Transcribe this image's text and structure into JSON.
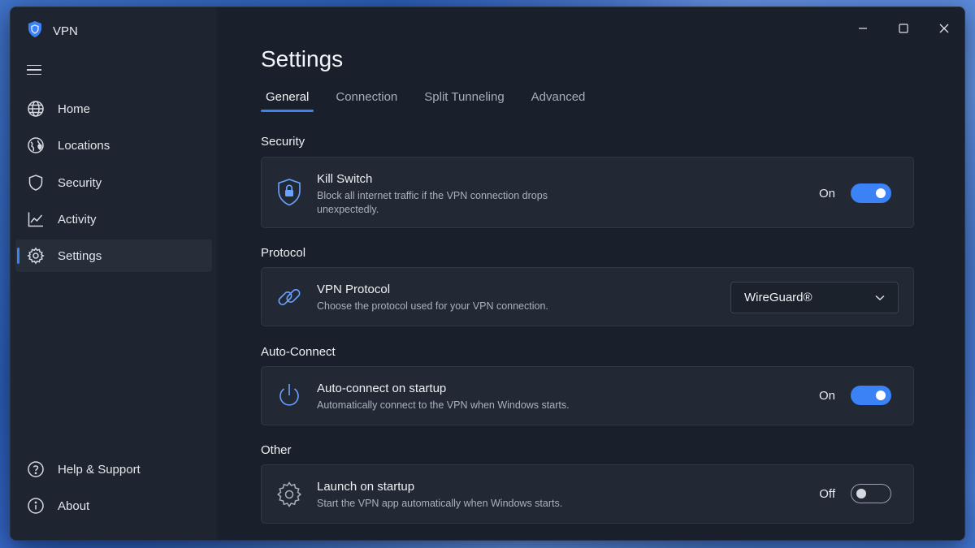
{
  "app": {
    "title": "VPN"
  },
  "sidebar": {
    "items": [
      {
        "label": "Home",
        "icon": "globe-icon"
      },
      {
        "label": "Locations",
        "icon": "world-pin-icon"
      },
      {
        "label": "Security",
        "icon": "shield-icon"
      },
      {
        "label": "Activity",
        "icon": "chart-icon"
      },
      {
        "label": "Settings",
        "icon": "gear-icon",
        "active": true
      }
    ],
    "footer": [
      {
        "label": "Help & Support",
        "icon": "help-icon"
      },
      {
        "label": "About",
        "icon": "info-icon"
      }
    ]
  },
  "page": {
    "title": "Settings"
  },
  "tabs": [
    {
      "label": "General",
      "active": true
    },
    {
      "label": "Connection"
    },
    {
      "label": "Split Tunneling"
    },
    {
      "label": "Advanced"
    }
  ],
  "sections": {
    "security": {
      "label": "Security",
      "kill_switch": {
        "title": "Kill Switch",
        "desc": "Block all internet traffic if the VPN connection drops unexpectedly.",
        "state_label": "On",
        "enabled": true
      }
    },
    "protocol": {
      "label": "Protocol",
      "vpn_protocol": {
        "title": "VPN Protocol",
        "desc": "Choose the protocol used for your VPN connection.",
        "selected": "WireGuard®"
      }
    },
    "auto_connect": {
      "label": "Auto-Connect",
      "startup": {
        "title": "Auto-connect on startup",
        "desc": "Automatically connect to the VPN when Windows starts.",
        "state_label": "On",
        "enabled": true
      }
    },
    "other": {
      "label": "Other",
      "launch": {
        "title": "Launch on startup",
        "desc": "Start the VPN app automatically when Windows starts.",
        "state_label": "Off",
        "enabled": false
      }
    }
  },
  "colors": {
    "accent": "#3b82f6",
    "window_bg": "#1a202b",
    "sidebar_bg": "#1e2530",
    "card_bg": "#222935"
  }
}
